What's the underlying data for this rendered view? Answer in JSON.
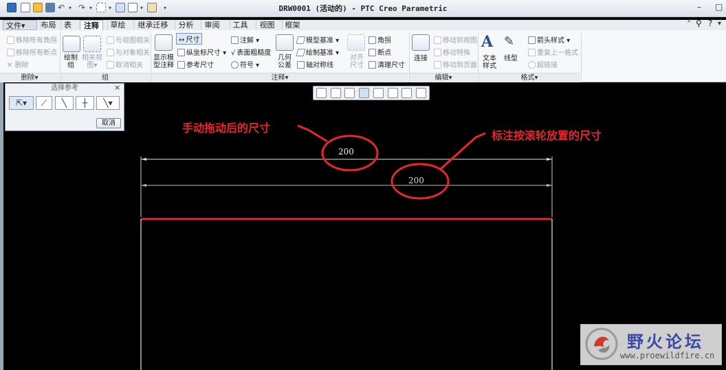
{
  "window": {
    "title": "DRW0001 (活动的) - PTC Creo Parametric",
    "minimize": "–",
    "maximize": "□",
    "close": "✕"
  },
  "tabs": [
    "布局",
    "表",
    "注释",
    "草绘",
    "继承迁移",
    "分析",
    "审阅",
    "工具",
    "视图",
    "框架"
  ],
  "file_menu": "文件▾",
  "ribbon": {
    "delete_group": {
      "label": "删除▾",
      "items": [
        "移除所有角拐",
        "移除所有断点",
        "删除"
      ]
    },
    "group_group": {
      "label": "组",
      "draw_group": "绘制\n组",
      "related_view": "相关视\n图▾",
      "items": [
        "与视图相关",
        "与对象相关",
        "取消相关"
      ]
    },
    "annotate_group": {
      "label": "注释▾",
      "show_model": "显示模\n型注释",
      "col1": [
        "尺寸",
        "纵坐标尺寸 ▾",
        "参考尺寸"
      ],
      "col2": [
        "注解 ▾",
        "表面粗糙度",
        "符号 ▾"
      ],
      "geo_tol": "几何\n公差",
      "col3": [
        "模型基准 ▾",
        "绘制基准 ▾",
        "轴对称线"
      ],
      "align": "对齐\n尺寸",
      "col4": [
        "角拐",
        "断点",
        "清理尺寸"
      ]
    },
    "edit_group": {
      "label": "编辑▾",
      "connect": "连接",
      "items": [
        "移动到视图",
        "移动特殊",
        "移动到页面"
      ]
    },
    "format_group": {
      "label": "格式▾",
      "text_style": "文本\n样式",
      "line_type": "线型",
      "items": [
        "箭头样式 ▾",
        "重复上一格式",
        "超链接"
      ]
    }
  },
  "select_dialog": {
    "title": "选择参考",
    "close": "×",
    "cancel": "取消"
  },
  "drawing": {
    "dim_upper": "200",
    "dim_lower": "200"
  },
  "annotations": {
    "left": "手动拖动后的尺寸",
    "right": "标注按滚轮放置的尺寸"
  },
  "watermark": {
    "name": "野火论坛",
    "url": "www.proewildfire.cn"
  },
  "colors": {
    "annotation": "#e8262b",
    "geometry_line": "#e8262b",
    "dimension": "#f0f0f0"
  }
}
